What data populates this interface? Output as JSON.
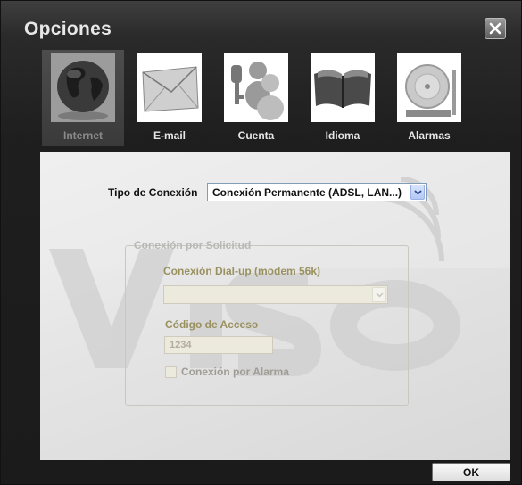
{
  "window": {
    "title": "Opciones",
    "close_icon": "close-icon"
  },
  "tabs": [
    {
      "label": "Internet",
      "icon": "globe-icon",
      "active": true
    },
    {
      "label": "E-mail",
      "icon": "envelope-icon",
      "active": false
    },
    {
      "label": "Cuenta",
      "icon": "users-key-icon",
      "active": false
    },
    {
      "label": "Idioma",
      "icon": "book-icon",
      "active": false
    },
    {
      "label": "Alarmas",
      "icon": "bell-icon",
      "active": false
    }
  ],
  "form": {
    "tipo_label": "Tipo de Conexión",
    "tipo_value": "Conexión Permanente (ADSL, LAN...)",
    "group_legend": "Conexión por Solicitud",
    "dialup_label": "Conexión Dial-up (modem 56k)",
    "dialup_value": "",
    "code_label": "Código de Acceso",
    "code_value": "1234",
    "alarm_checkbox_label": "Conexión por Alarma",
    "alarm_checked": false
  },
  "footer": {
    "ok_label": "OK"
  },
  "watermark": "VISO",
  "colors": {
    "window_bg": "#1e1e1e",
    "panel_bg": "#e6e6e6",
    "disabled_text": "#9a9160",
    "select_border": "#7f9db9"
  }
}
